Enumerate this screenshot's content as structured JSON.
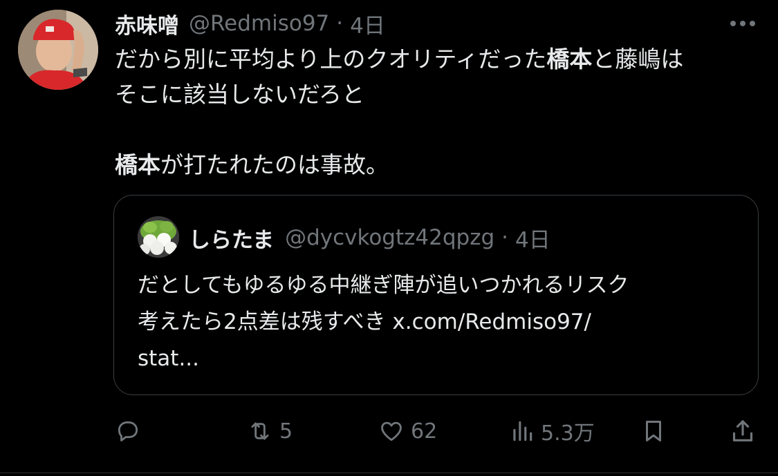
{
  "tweet": {
    "author": {
      "display_name": "赤味噌",
      "handle": "@Redmiso97"
    },
    "separator": "·",
    "time": "4日",
    "text": {
      "line1": {
        "part1": "だから別に平均より上のクオリティだった",
        "bold1": "橋本",
        "part2": "と藤嶋は"
      },
      "line2": "そこに該当しないだろと",
      "line3": {
        "bold": "橋本",
        "rest": "が打たれたのは事故。"
      }
    },
    "quote": {
      "author": {
        "display_name": "しらたま",
        "handle": "@dycvkogtz42qpzg"
      },
      "separator": "·",
      "time": "4日",
      "lines": [
        "だとしてもゆるゆる中継ぎ陣が追いつかれるリスク",
        "考えたら2点差は残すべき x.com/Redmiso97/",
        "stat..."
      ]
    },
    "actions": {
      "reply": {
        "icon": "reply-icon",
        "count": ""
      },
      "retweet": {
        "icon": "retweet-icon",
        "count": "5"
      },
      "like": {
        "icon": "heart-icon",
        "count": "62"
      },
      "views": {
        "icon": "views-icon",
        "count": "5.3万"
      },
      "bookmark": {
        "icon": "bookmark-icon"
      },
      "share": {
        "icon": "share-icon"
      }
    }
  },
  "colors": {
    "background": "#000000",
    "text_primary": "#e7e9ea",
    "text_secondary": "#71767b",
    "border": "#3a3e42",
    "avatar_cap": "#d8282b"
  }
}
